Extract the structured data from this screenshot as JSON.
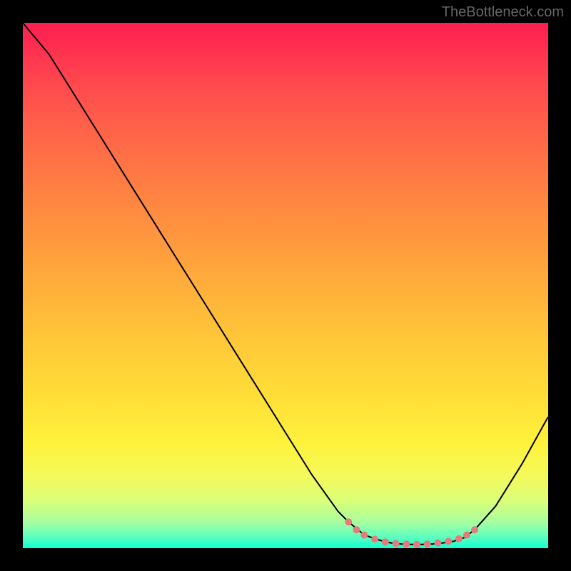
{
  "watermark": "TheBottleneck.com",
  "chart_data": {
    "type": "line",
    "title": "",
    "xlabel": "",
    "ylabel": "",
    "xlim": [
      0,
      100
    ],
    "ylim": [
      0,
      100
    ],
    "series": [
      {
        "name": "bottleneck-curve",
        "x": [
          0,
          5,
          10,
          15,
          20,
          25,
          30,
          35,
          40,
          45,
          50,
          55,
          60,
          62,
          65,
          68,
          70,
          72,
          74,
          76,
          78,
          80,
          82,
          84,
          86,
          90,
          95,
          100
        ],
        "values": [
          100,
          94,
          86,
          78,
          70,
          62,
          54,
          46,
          38,
          30,
          22,
          14,
          7,
          5,
          2.5,
          1.5,
          1,
          0.8,
          0.7,
          0.7,
          0.8,
          1,
          1.3,
          2,
          3.5,
          8,
          16,
          25
        ]
      }
    ],
    "markers": {
      "name": "highlight-dots",
      "color": "#e97a7a",
      "points": [
        {
          "x": 62,
          "y": 5
        },
        {
          "x": 63.5,
          "y": 3.5
        },
        {
          "x": 65,
          "y": 2.5
        },
        {
          "x": 67,
          "y": 1.7
        },
        {
          "x": 69,
          "y": 1.2
        },
        {
          "x": 71,
          "y": 0.9
        },
        {
          "x": 73,
          "y": 0.8
        },
        {
          "x": 75,
          "y": 0.7
        },
        {
          "x": 77,
          "y": 0.8
        },
        {
          "x": 79,
          "y": 1
        },
        {
          "x": 81,
          "y": 1.3
        },
        {
          "x": 83,
          "y": 1.8
        },
        {
          "x": 84.5,
          "y": 2.5
        },
        {
          "x": 86,
          "y": 3.5
        }
      ]
    }
  }
}
